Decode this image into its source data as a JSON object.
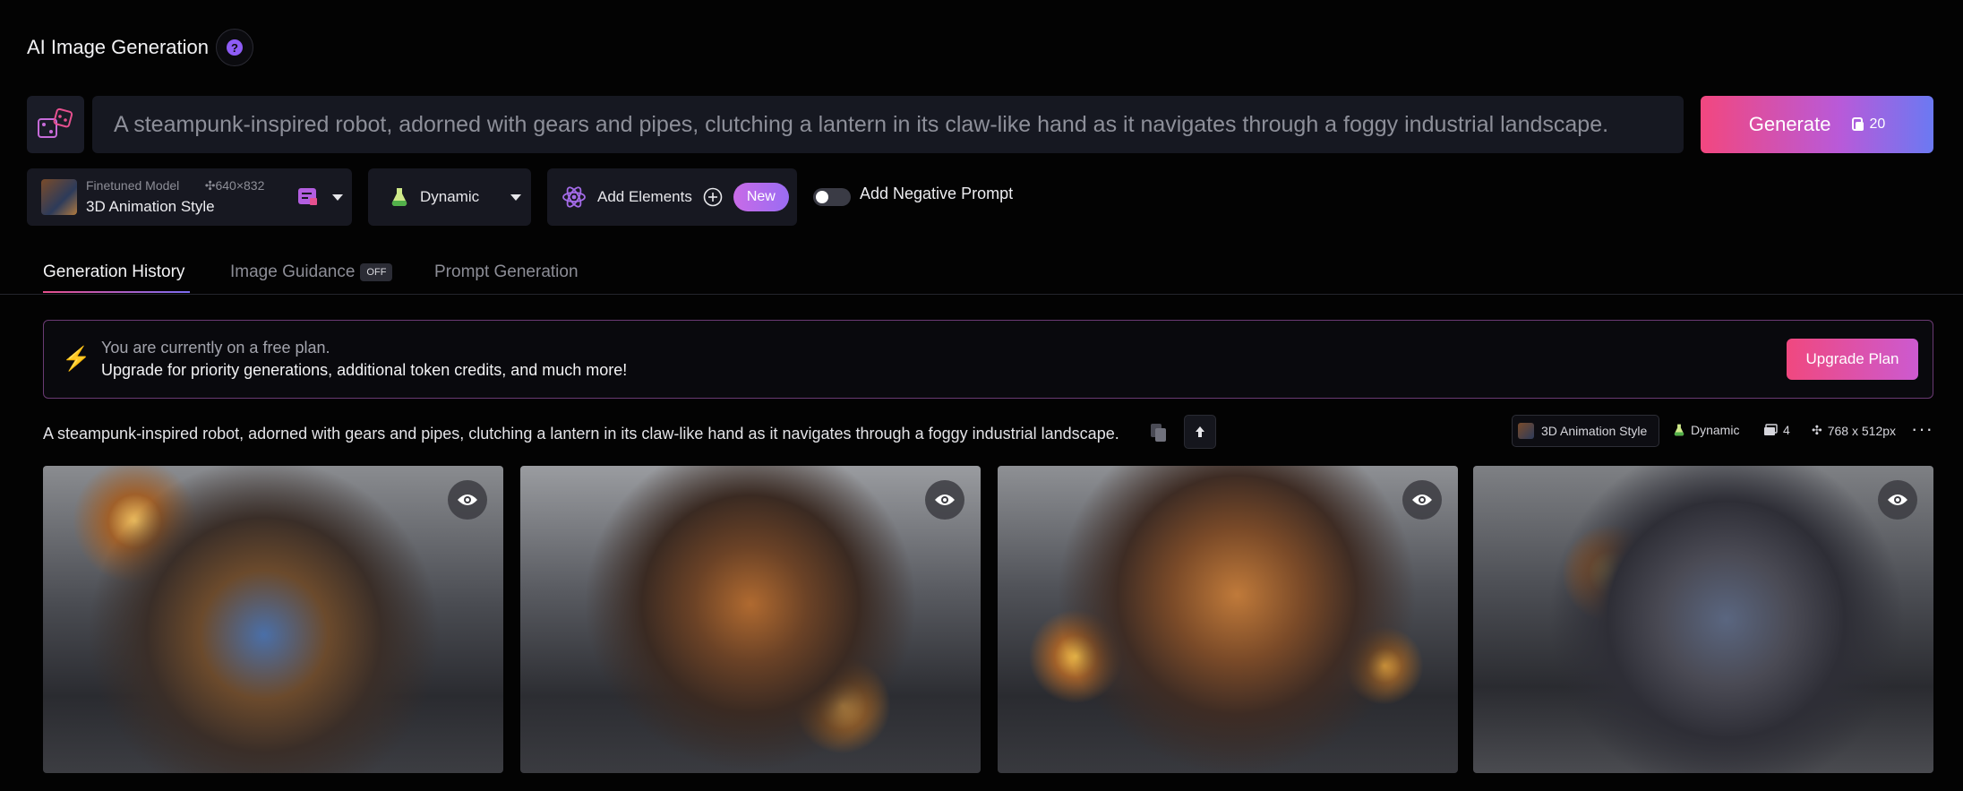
{
  "header": {
    "title": "AI Image Generation",
    "help_icon": "?"
  },
  "prompt": {
    "value": "A steampunk-inspired robot, adorned with gears and pipes, clutching a lantern in its claw-like hand as it navigates through a foggy industrial landscape."
  },
  "generate": {
    "label": "Generate",
    "token_cost": "20"
  },
  "model": {
    "kind": "Finetuned Model",
    "dimensions": "640×832",
    "name": "3D Animation Style"
  },
  "preset": {
    "label": "Dynamic"
  },
  "elements": {
    "label": "Add Elements",
    "badge": "New"
  },
  "negative_prompt": {
    "label": "Add Negative Prompt",
    "enabled": false
  },
  "tabs": [
    {
      "label": "Generation History",
      "active": true
    },
    {
      "label": "Image Guidance",
      "badge": "OFF"
    },
    {
      "label": "Prompt Generation"
    }
  ],
  "banner": {
    "line1": "You are currently on a free plan.",
    "line2": "Upgrade for priority generations, additional token credits, and much more!",
    "button": "Upgrade Plan"
  },
  "generation": {
    "prompt": "A steampunk-inspired robot, adorned with gears and pipes, clutching a lantern in its claw-like hand as it navigates through a foggy industrial landscape.",
    "style": "3D Animation Style",
    "preset": "Dynamic",
    "count": "4",
    "dimensions": "768 x 512px",
    "images": [
      {
        "name": "robot-image-1"
      },
      {
        "name": "robot-image-2"
      },
      {
        "name": "robot-image-3"
      },
      {
        "name": "robot-image-4"
      }
    ]
  },
  "colors": {
    "accent_pink": "#f2477f",
    "accent_purple": "#8e5cf6",
    "accent_blue": "#6b79f2",
    "background": "#030303"
  },
  "icons": [
    "help-icon",
    "dice-icon",
    "token-icon",
    "model-style-icon",
    "chevron-down-icon",
    "potion-icon",
    "atom-icon",
    "plus-circle-icon",
    "bolt-icon",
    "copy-icon",
    "arrow-up-icon",
    "images-count-icon",
    "move-icon",
    "more-icon",
    "eye-icon"
  ]
}
